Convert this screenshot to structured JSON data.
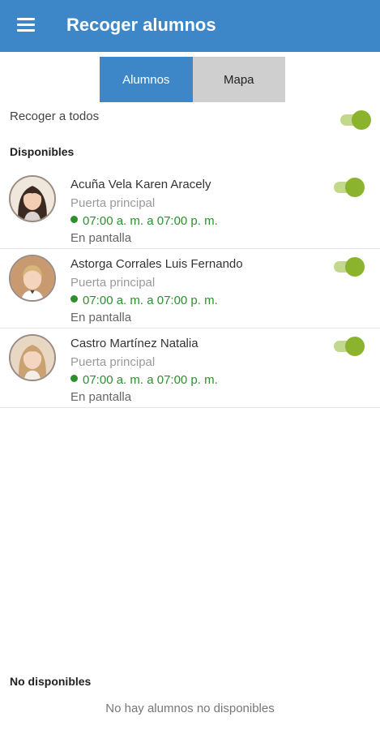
{
  "header": {
    "title": "Recoger alumnos",
    "menu_icon": "hamburger-menu-icon",
    "background": "#3d87c9"
  },
  "tabs": [
    {
      "label": "Alumnos",
      "active": true
    },
    {
      "label": "Mapa",
      "active": false
    }
  ],
  "pick_all": {
    "label": "Recoger a todos",
    "on": true
  },
  "available": {
    "title": "Disponibles",
    "students": [
      {
        "name": "Acuña Vela Karen Aracely",
        "gate": "Puerta principal",
        "hours": "07:00 a. m. a 07:00 p. m.",
        "status": "En pantalla",
        "selected": true
      },
      {
        "name": "Astorga Corrales Luis Fernando",
        "gate": "Puerta principal",
        "hours": "07:00 a. m. a 07:00 p. m.",
        "status": "En pantalla",
        "selected": true
      },
      {
        "name": "Castro Martínez Natalia",
        "gate": "Puerta principal",
        "hours": "07:00 a. m. a 07:00 p. m.",
        "status": "En pantalla",
        "selected": true
      }
    ]
  },
  "unavailable": {
    "title": "No disponibles",
    "empty_message": "No hay alumnos no disponibles"
  },
  "colors": {
    "accent": "#3d87c9",
    "toggle_on": "#8cb32d",
    "schedule_green": "#2e8f2e"
  }
}
